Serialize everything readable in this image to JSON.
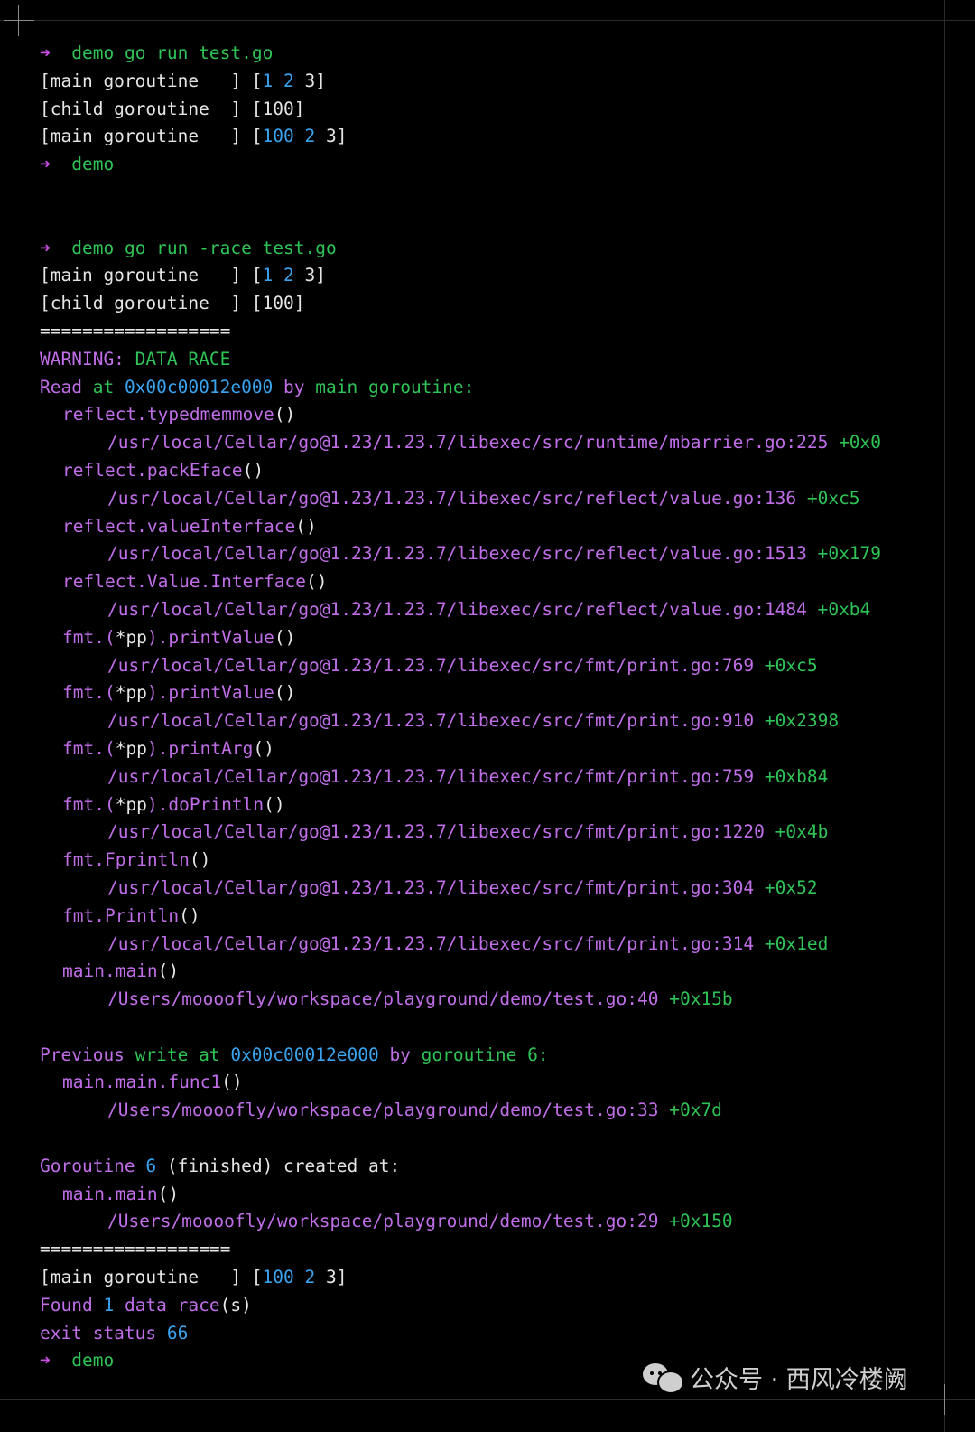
{
  "prompt_symbol": "➜",
  "lines": [
    {
      "type": "prompt",
      "dir": "demo",
      "cmd": "go run test.go"
    },
    {
      "type": "out",
      "segs": [
        {
          "t": "[main goroutine   ] [",
          "c": "w"
        },
        {
          "t": "1",
          "c": "b"
        },
        {
          "t": " ",
          "c": "w"
        },
        {
          "t": "2",
          "c": "b"
        },
        {
          "t": " 3]",
          "c": "w"
        }
      ]
    },
    {
      "type": "out",
      "segs": [
        {
          "t": "[child goroutine  ] [100]",
          "c": "w"
        }
      ]
    },
    {
      "type": "out",
      "segs": [
        {
          "t": "[main goroutine   ] [",
          "c": "w"
        },
        {
          "t": "100",
          "c": "b"
        },
        {
          "t": " ",
          "c": "w"
        },
        {
          "t": "2",
          "c": "b"
        },
        {
          "t": " 3]",
          "c": "w"
        }
      ]
    },
    {
      "type": "prompt",
      "dir": "demo",
      "cmd": ""
    },
    {
      "type": "blank"
    },
    {
      "type": "blank"
    },
    {
      "type": "prompt",
      "dir": "demo",
      "cmd": "go run -race test.go"
    },
    {
      "type": "out",
      "segs": [
        {
          "t": "[main goroutine   ] [",
          "c": "w"
        },
        {
          "t": "1",
          "c": "b"
        },
        {
          "t": " ",
          "c": "w"
        },
        {
          "t": "2",
          "c": "b"
        },
        {
          "t": " 3]",
          "c": "w"
        }
      ]
    },
    {
      "type": "out",
      "segs": [
        {
          "t": "[child goroutine  ] [100]",
          "c": "w"
        }
      ]
    },
    {
      "type": "out",
      "segs": [
        {
          "t": "==================",
          "c": "w"
        }
      ]
    },
    {
      "type": "out",
      "segs": [
        {
          "t": "WARNING:",
          "c": "m"
        },
        {
          "t": " DATA RACE",
          "c": "g"
        }
      ]
    },
    {
      "type": "out",
      "segs": [
        {
          "t": "Read",
          "c": "m"
        },
        {
          "t": " at ",
          "c": "g"
        },
        {
          "t": "0x00c00012e000",
          "c": "b"
        },
        {
          "t": " by ",
          "c": "m"
        },
        {
          "t": "main goroutine:",
          "c": "g"
        }
      ]
    },
    {
      "type": "out",
      "indent": 1,
      "segs": [
        {
          "t": "reflect.typedmemmove",
          "c": "m"
        },
        {
          "t": "()",
          "c": "w"
        }
      ]
    },
    {
      "type": "out",
      "indent": 2,
      "segs": [
        {
          "t": "/usr/local/Cellar/go@1.23/1.23.7/libexec/src/runtime/mbarrier.go:225",
          "c": "m"
        },
        {
          "t": " +0x0",
          "c": "g"
        }
      ]
    },
    {
      "type": "out",
      "indent": 1,
      "segs": [
        {
          "t": "reflect.packEface",
          "c": "m"
        },
        {
          "t": "()",
          "c": "w"
        }
      ]
    },
    {
      "type": "out",
      "indent": 2,
      "segs": [
        {
          "t": "/usr/local/Cellar/go@1.23/1.23.7/libexec/src/reflect/value.go:136",
          "c": "m"
        },
        {
          "t": " +0xc5",
          "c": "g"
        }
      ]
    },
    {
      "type": "out",
      "indent": 1,
      "segs": [
        {
          "t": "reflect.valueInterface",
          "c": "m"
        },
        {
          "t": "()",
          "c": "w"
        }
      ]
    },
    {
      "type": "out",
      "indent": 2,
      "segs": [
        {
          "t": "/usr/local/Cellar/go@1.23/1.23.7/libexec/src/reflect/value.go:1513",
          "c": "m"
        },
        {
          "t": " +0x179",
          "c": "g"
        }
      ]
    },
    {
      "type": "out",
      "indent": 1,
      "segs": [
        {
          "t": "reflect.Value.Interface",
          "c": "m"
        },
        {
          "t": "()",
          "c": "w"
        }
      ]
    },
    {
      "type": "out",
      "indent": 2,
      "segs": [
        {
          "t": "/usr/local/Cellar/go@1.23/1.23.7/libexec/src/reflect/value.go:1484",
          "c": "m"
        },
        {
          "t": " +0xb4",
          "c": "g"
        }
      ]
    },
    {
      "type": "out",
      "indent": 1,
      "segs": [
        {
          "t": "fmt.(",
          "c": "m"
        },
        {
          "t": "*pp",
          "c": "w"
        },
        {
          "t": ").printValue",
          "c": "m"
        },
        {
          "t": "()",
          "c": "w"
        }
      ]
    },
    {
      "type": "out",
      "indent": 2,
      "segs": [
        {
          "t": "/usr/local/Cellar/go@1.23/1.23.7/libexec/src/fmt/print.go:769",
          "c": "m"
        },
        {
          "t": " +0xc5",
          "c": "g"
        }
      ]
    },
    {
      "type": "out",
      "indent": 1,
      "segs": [
        {
          "t": "fmt.(",
          "c": "m"
        },
        {
          "t": "*pp",
          "c": "w"
        },
        {
          "t": ").printValue",
          "c": "m"
        },
        {
          "t": "()",
          "c": "w"
        }
      ]
    },
    {
      "type": "out",
      "indent": 2,
      "segs": [
        {
          "t": "/usr/local/Cellar/go@1.23/1.23.7/libexec/src/fmt/print.go:910",
          "c": "m"
        },
        {
          "t": " +0x2398",
          "c": "g"
        }
      ]
    },
    {
      "type": "out",
      "indent": 1,
      "segs": [
        {
          "t": "fmt.(",
          "c": "m"
        },
        {
          "t": "*pp",
          "c": "w"
        },
        {
          "t": ").printArg",
          "c": "m"
        },
        {
          "t": "()",
          "c": "w"
        }
      ]
    },
    {
      "type": "out",
      "indent": 2,
      "segs": [
        {
          "t": "/usr/local/Cellar/go@1.23/1.23.7/libexec/src/fmt/print.go:759",
          "c": "m"
        },
        {
          "t": " +0xb84",
          "c": "g"
        }
      ]
    },
    {
      "type": "out",
      "indent": 1,
      "segs": [
        {
          "t": "fmt.(",
          "c": "m"
        },
        {
          "t": "*pp",
          "c": "w"
        },
        {
          "t": ").doPrintln",
          "c": "m"
        },
        {
          "t": "()",
          "c": "w"
        }
      ]
    },
    {
      "type": "out",
      "indent": 2,
      "segs": [
        {
          "t": "/usr/local/Cellar/go@1.23/1.23.7/libexec/src/fmt/print.go:1220",
          "c": "m"
        },
        {
          "t": " +0x4b",
          "c": "g"
        }
      ]
    },
    {
      "type": "out",
      "indent": 1,
      "segs": [
        {
          "t": "fmt.Fprintln",
          "c": "m"
        },
        {
          "t": "()",
          "c": "w"
        }
      ]
    },
    {
      "type": "out",
      "indent": 2,
      "segs": [
        {
          "t": "/usr/local/Cellar/go@1.23/1.23.7/libexec/src/fmt/print.go:304",
          "c": "m"
        },
        {
          "t": " +0x52",
          "c": "g"
        }
      ]
    },
    {
      "type": "out",
      "indent": 1,
      "segs": [
        {
          "t": "fmt.Println",
          "c": "m"
        },
        {
          "t": "()",
          "c": "w"
        }
      ]
    },
    {
      "type": "out",
      "indent": 2,
      "segs": [
        {
          "t": "/usr/local/Cellar/go@1.23/1.23.7/libexec/src/fmt/print.go:314",
          "c": "m"
        },
        {
          "t": " +0x1ed",
          "c": "g"
        }
      ]
    },
    {
      "type": "out",
      "indent": 1,
      "segs": [
        {
          "t": "main.main",
          "c": "m"
        },
        {
          "t": "()",
          "c": "w"
        }
      ]
    },
    {
      "type": "out",
      "indent": 2,
      "segs": [
        {
          "t": "/Users/moooofly/workspace/playground/demo/test.go:40",
          "c": "m"
        },
        {
          "t": " +0x15b",
          "c": "g"
        }
      ]
    },
    {
      "type": "blank"
    },
    {
      "type": "out",
      "segs": [
        {
          "t": "Previous",
          "c": "m"
        },
        {
          "t": " write at ",
          "c": "g"
        },
        {
          "t": "0x00c00012e000",
          "c": "b"
        },
        {
          "t": " by ",
          "c": "m"
        },
        {
          "t": "goroutine 6:",
          "c": "g"
        }
      ]
    },
    {
      "type": "out",
      "indent": 1,
      "segs": [
        {
          "t": "main.main.func1",
          "c": "m"
        },
        {
          "t": "()",
          "c": "w"
        }
      ]
    },
    {
      "type": "out",
      "indent": 2,
      "segs": [
        {
          "t": "/Users/moooofly/workspace/playground/demo/test.go:33",
          "c": "m"
        },
        {
          "t": " +0x7d",
          "c": "g"
        }
      ]
    },
    {
      "type": "blank"
    },
    {
      "type": "out",
      "segs": [
        {
          "t": "Goroutine",
          "c": "m"
        },
        {
          "t": " ",
          "c": "w"
        },
        {
          "t": "6",
          "c": "b"
        },
        {
          "t": " (finished) created at:",
          "c": "w"
        }
      ]
    },
    {
      "type": "out",
      "indent": 1,
      "segs": [
        {
          "t": "main.main",
          "c": "m"
        },
        {
          "t": "()",
          "c": "w"
        }
      ]
    },
    {
      "type": "out",
      "indent": 2,
      "segs": [
        {
          "t": "/Users/moooofly/workspace/playground/demo/test.go:29",
          "c": "m"
        },
        {
          "t": " +0x150",
          "c": "g"
        }
      ]
    },
    {
      "type": "out",
      "segs": [
        {
          "t": "==================",
          "c": "w"
        }
      ]
    },
    {
      "type": "out",
      "segs": [
        {
          "t": "[main goroutine   ] [",
          "c": "w"
        },
        {
          "t": "100",
          "c": "b"
        },
        {
          "t": " ",
          "c": "w"
        },
        {
          "t": "2",
          "c": "b"
        },
        {
          "t": " 3]",
          "c": "w"
        }
      ]
    },
    {
      "type": "out",
      "segs": [
        {
          "t": "Found",
          "c": "m"
        },
        {
          "t": " ",
          "c": "w"
        },
        {
          "t": "1",
          "c": "b"
        },
        {
          "t": " ",
          "c": "w"
        },
        {
          "t": "data race",
          "c": "m"
        },
        {
          "t": "(s)",
          "c": "w"
        }
      ]
    },
    {
      "type": "out",
      "segs": [
        {
          "t": "exit status",
          "c": "m"
        },
        {
          "t": " ",
          "c": "w"
        },
        {
          "t": "66",
          "c": "b"
        }
      ]
    },
    {
      "type": "prompt",
      "dir": "demo",
      "cmd": ""
    }
  ],
  "watermark": {
    "text": "公众号 · 西风冷楼阙",
    "icon": "wechat-icon"
  },
  "colors": {
    "background": "#000000",
    "green": "#2fc356",
    "blue": "#3aa3ee",
    "magenta": "#c06ee8",
    "white": "#e6e6e6"
  }
}
